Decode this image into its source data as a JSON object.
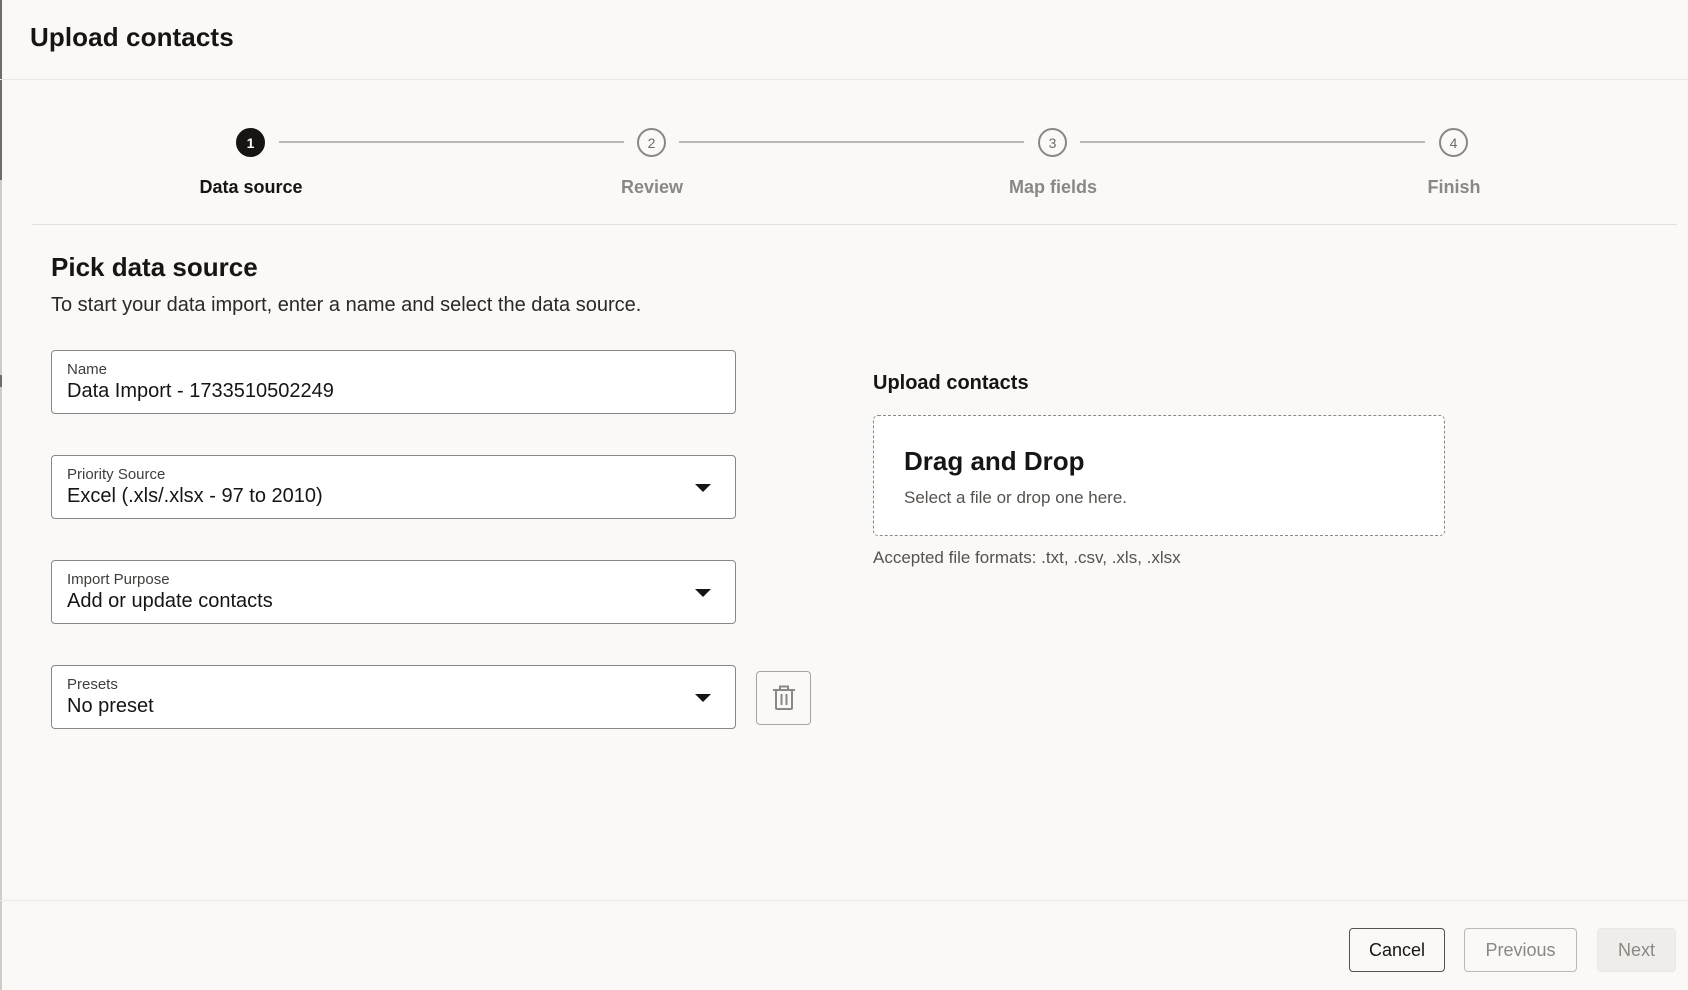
{
  "dialog": {
    "title": "Upload contacts"
  },
  "stepper": {
    "steps": [
      {
        "number": "1",
        "label": "Data source",
        "state": "active"
      },
      {
        "number": "2",
        "label": "Review",
        "state": "pending"
      },
      {
        "number": "3",
        "label": "Map fields",
        "state": "pending"
      },
      {
        "number": "4",
        "label": "Finish",
        "state": "pending"
      }
    ]
  },
  "main": {
    "title": "Pick data source",
    "description": "To start your data import, enter a name and select the data source.",
    "fields": {
      "name": {
        "label": "Name",
        "value": "Data Import - 1733510502249"
      },
      "priority_source": {
        "label": "Priority Source",
        "value": "Excel (.xls/.xlsx - 97 to 2010)"
      },
      "import_purpose": {
        "label": "Import Purpose",
        "value": "Add or update contacts"
      },
      "presets": {
        "label": "Presets",
        "value": "No preset"
      }
    }
  },
  "upload": {
    "title": "Upload contacts",
    "dropzone_title": "Drag and Drop",
    "dropzone_subtitle": "Select a file or drop one here.",
    "accepted_formats": "Accepted file formats: .txt, .csv, .xls, .xlsx"
  },
  "footer": {
    "cancel_label": "Cancel",
    "previous_label": "Previous",
    "next_label": "Next"
  },
  "icons": {
    "delete_preset": "trash-icon",
    "dropdown": "chevron-down-icon"
  },
  "colors": {
    "active_step": "#161513",
    "text_primary": "#161513",
    "text_muted": "#8a8784",
    "background": "#faf9f8"
  }
}
